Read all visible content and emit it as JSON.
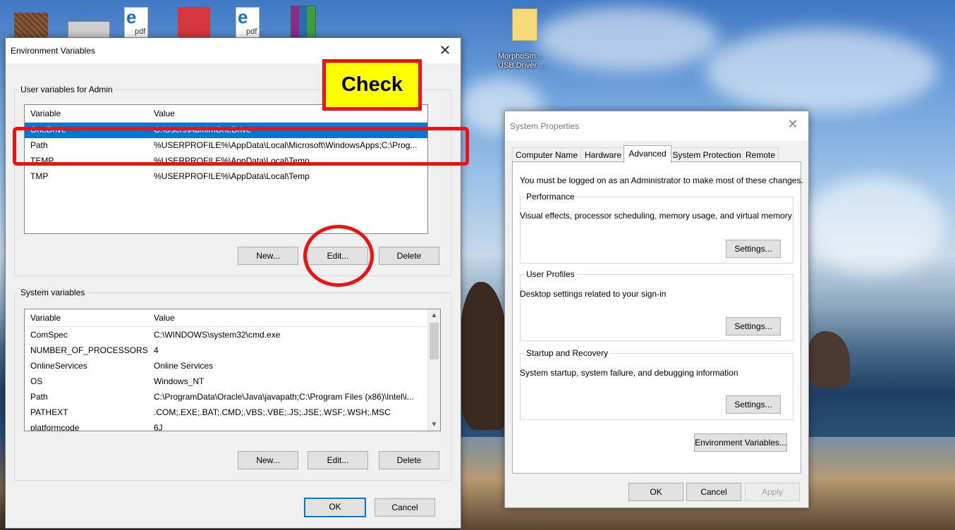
{
  "desktop": {
    "icons": [
      {
        "name": "image-thumbnail-icon",
        "label": ""
      },
      {
        "name": "drive-icon",
        "label": ""
      },
      {
        "name": "edge-pdf-icon",
        "label": "pdf"
      },
      {
        "name": "red-document-icon",
        "label": ""
      },
      {
        "name": "edge-pdf-icon-2",
        "label": "pdf"
      },
      {
        "name": "winrar-archive-icon",
        "label": ""
      },
      {
        "name": "folder-icon",
        "label": "MorphoSm... USB Driver ..."
      }
    ]
  },
  "env_window": {
    "title": "Environment Variables",
    "user_group_label": "User variables for Admin",
    "columns": [
      "Variable",
      "Value"
    ],
    "user_rows": [
      {
        "variable": "OneDrive",
        "value": "C:\\Users\\Admin\\OneDrive",
        "selected": true
      },
      {
        "variable": "Path",
        "value": "%USERPROFILE%\\AppData\\Local\\Microsoft\\WindowsApps;C:\\Prog...",
        "selected": false
      },
      {
        "variable": "TEMP",
        "value": "%USERPROFILE%\\AppData\\Local\\Temp",
        "selected": false
      },
      {
        "variable": "TMP",
        "value": "%USERPROFILE%\\AppData\\Local\\Temp",
        "selected": false
      }
    ],
    "user_buttons": {
      "new": "New...",
      "edit": "Edit...",
      "delete": "Delete"
    },
    "system_group_label": "System variables",
    "system_rows": [
      {
        "variable": "ComSpec",
        "value": "C:\\WINDOWS\\system32\\cmd.exe"
      },
      {
        "variable": "NUMBER_OF_PROCESSORS",
        "value": "4"
      },
      {
        "variable": "OnlineServices",
        "value": "Online Services"
      },
      {
        "variable": "OS",
        "value": "Windows_NT"
      },
      {
        "variable": "Path",
        "value": "C:\\ProgramData\\Oracle\\Java\\javapath;C:\\Program Files (x86)\\Intel\\i..."
      },
      {
        "variable": "PATHEXT",
        "value": ".COM;.EXE;.BAT;.CMD;.VBS;.VBE;.JS;.JSE;.WSF;.WSH;.MSC"
      },
      {
        "variable": "platformcode",
        "value": "6J"
      }
    ],
    "system_buttons": {
      "new": "New...",
      "edit": "Edit...",
      "delete": "Delete"
    },
    "ok": "OK",
    "cancel": "Cancel"
  },
  "sys_window": {
    "title": "System Properties",
    "tabs": [
      "Computer Name",
      "Hardware",
      "Advanced",
      "System Protection",
      "Remote"
    ],
    "active_tab": "Advanced",
    "admin_note": "You must be logged on as an Administrator to make most of these changes.",
    "performance": {
      "label": "Performance",
      "desc": "Visual effects, processor scheduling, memory usage, and virtual memory",
      "button": "Settings..."
    },
    "user_profiles": {
      "label": "User Profiles",
      "desc": "Desktop settings related to your sign-in",
      "button": "Settings..."
    },
    "startup": {
      "label": "Startup and Recovery",
      "desc": "System startup, system failure, and debugging information",
      "button": "Settings..."
    },
    "env_button": "Environment Variables...",
    "ok": "OK",
    "cancel": "Cancel",
    "apply": "Apply"
  },
  "annotations": {
    "check_label": "Check",
    "color": "#ee1111"
  }
}
